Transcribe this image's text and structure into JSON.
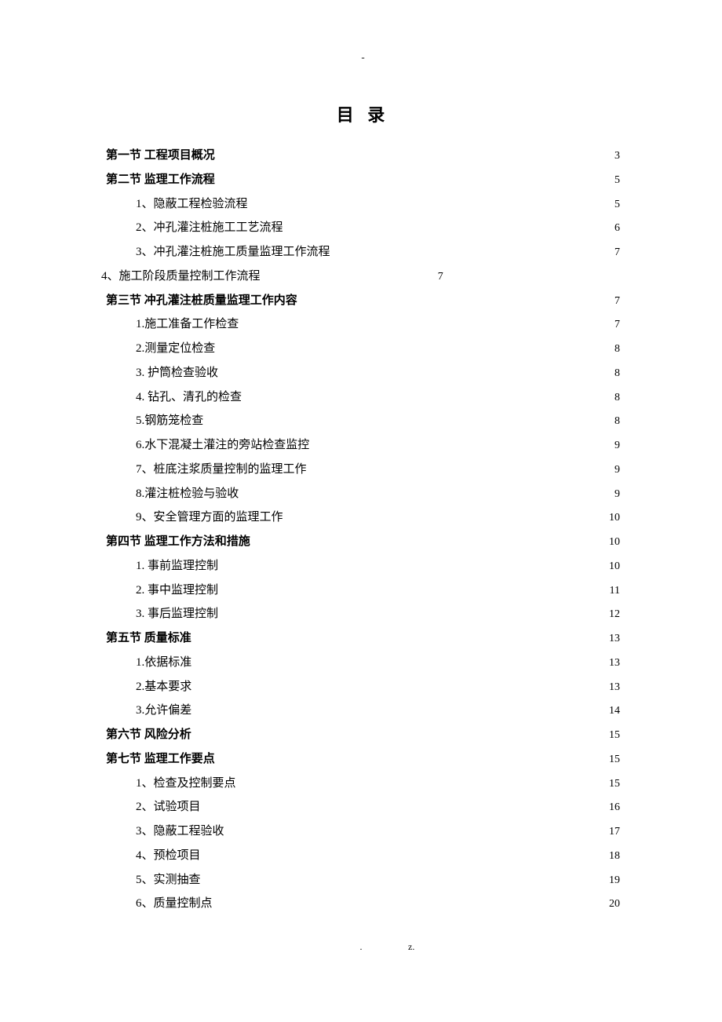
{
  "header_dash": "-",
  "title": "目 录",
  "toc": [
    {
      "label": "第一节 工程项目概况",
      "page": "3",
      "indent": "indent0",
      "bold": true
    },
    {
      "label": "第二节   监理工作流程",
      "page": "5",
      "indent": "indent0",
      "bold": true
    },
    {
      "label": "1、隐蔽工程检验流程",
      "page": "5",
      "indent": "indent1",
      "bold": false
    },
    {
      "label": "2、冲孔灌注桩施工工艺流程",
      "page": "6",
      "indent": "indent1",
      "bold": false
    },
    {
      "label": "3、冲孔灌注桩施工质量监理工作流程",
      "page": "7",
      "indent": "indent1",
      "bold": false
    },
    {
      "label": "4、施工阶段质量控制工作流程",
      "page": "7",
      "indent": "indent-sp",
      "bold": false,
      "short": true
    },
    {
      "label": "第三节   冲孔灌注桩质量监理工作内容",
      "page": "7",
      "indent": "indent0",
      "bold": true
    },
    {
      "label": "1.施工准备工作检查",
      "page": "7",
      "indent": "indent1",
      "bold": false
    },
    {
      "label": "2.测量定位检查",
      "page": "8",
      "indent": "indent1",
      "bold": false
    },
    {
      "label": "3. 护筒检查验收",
      "page": "8",
      "indent": "indent1",
      "bold": false
    },
    {
      "label": "4. 钻孔、清孔的检查",
      "page": "8",
      "indent": "indent1",
      "bold": false
    },
    {
      "label": "5.钢筋笼检查",
      "page": "8",
      "indent": "indent1",
      "bold": false
    },
    {
      "label": "6.水下混凝土灌注的旁站检查监控",
      "page": "9",
      "indent": "indent1",
      "bold": false
    },
    {
      "label": "7、桩底注浆质量控制的监理工作",
      "page": "9",
      "indent": "indent1",
      "bold": false
    },
    {
      "label": "8.灌注桩检验与验收",
      "page": "9",
      "indent": "indent1",
      "bold": false
    },
    {
      "label": "9、安全管理方面的监理工作",
      "page": "10",
      "indent": "indent1",
      "bold": false
    },
    {
      "label": "第四节   监理工作方法和措施",
      "page": "10",
      "indent": "indent0",
      "bold": true
    },
    {
      "label": "1. 事前监理控制",
      "page": "10",
      "indent": "indent1",
      "bold": false
    },
    {
      "label": "2. 事中监理控制",
      "page": "11",
      "indent": "indent1",
      "bold": false
    },
    {
      "label": "3. 事后监理控制",
      "page": "12",
      "indent": "indent1",
      "bold": false
    },
    {
      "label": "第五节   质量标准",
      "page": "13",
      "indent": "indent0",
      "bold": true
    },
    {
      "label": "1.依据标准",
      "page": "13",
      "indent": "indent1",
      "bold": false
    },
    {
      "label": "2.基本要求",
      "page": "13",
      "indent": "indent1",
      "bold": false
    },
    {
      "label": "3.允许偏差",
      "page": "14",
      "indent": "indent1",
      "bold": false
    },
    {
      "label": "第六节   风险分析",
      "page": "15",
      "indent": "indent0",
      "bold": true
    },
    {
      "label": "第七节 监理工作要点",
      "page": "15",
      "indent": "indent0",
      "bold": true
    },
    {
      "label": "1、检查及控制要点",
      "page": "15",
      "indent": "indent1",
      "bold": false
    },
    {
      "label": "2、试验项目",
      "page": "16",
      "indent": "indent1",
      "bold": false
    },
    {
      "label": "3、隐蔽工程验收",
      "page": "17",
      "indent": "indent1",
      "bold": false
    },
    {
      "label": "4、预检项目",
      "page": "18",
      "indent": "indent1",
      "bold": false
    },
    {
      "label": "5、实测抽查",
      "page": "19",
      "indent": "indent1",
      "bold": false
    },
    {
      "label": "6、质量控制点",
      "page": "20",
      "indent": "indent1",
      "bold": false
    }
  ],
  "footer_left": ".",
  "footer_right": "z."
}
